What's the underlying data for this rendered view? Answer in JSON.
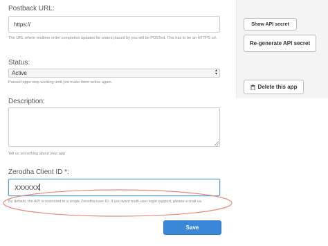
{
  "form": {
    "postback": {
      "label": "Postback URL:",
      "value": "https://",
      "help": "The URL where realtime order completion updates for orders placed by you will be POSTed. This has to be an HTTPS url."
    },
    "status": {
      "label": "Status:",
      "selected": "Active",
      "help": "Paused apps stop working until you make them active again."
    },
    "description": {
      "label": "Description:",
      "value": "",
      "help": "Tell us something about your app"
    },
    "client_id": {
      "label": "Zerodha Client ID *:",
      "value": "XXXXXX",
      "help": "By default, the API is restricted to a single Zerodha user ID. If you want multi-user login support, please e-mail us."
    },
    "save_label": "Save"
  },
  "sidebar": {
    "show_secret_label": "Show API secret",
    "regenerate_label": "Re-generate API secret",
    "delete_label": "Delete this app",
    "delete_icon": "trash-icon"
  },
  "colors": {
    "primary": "#3a87d8",
    "focus_border": "#5b9bd5",
    "annotation_ellipse": "#e8857a"
  }
}
